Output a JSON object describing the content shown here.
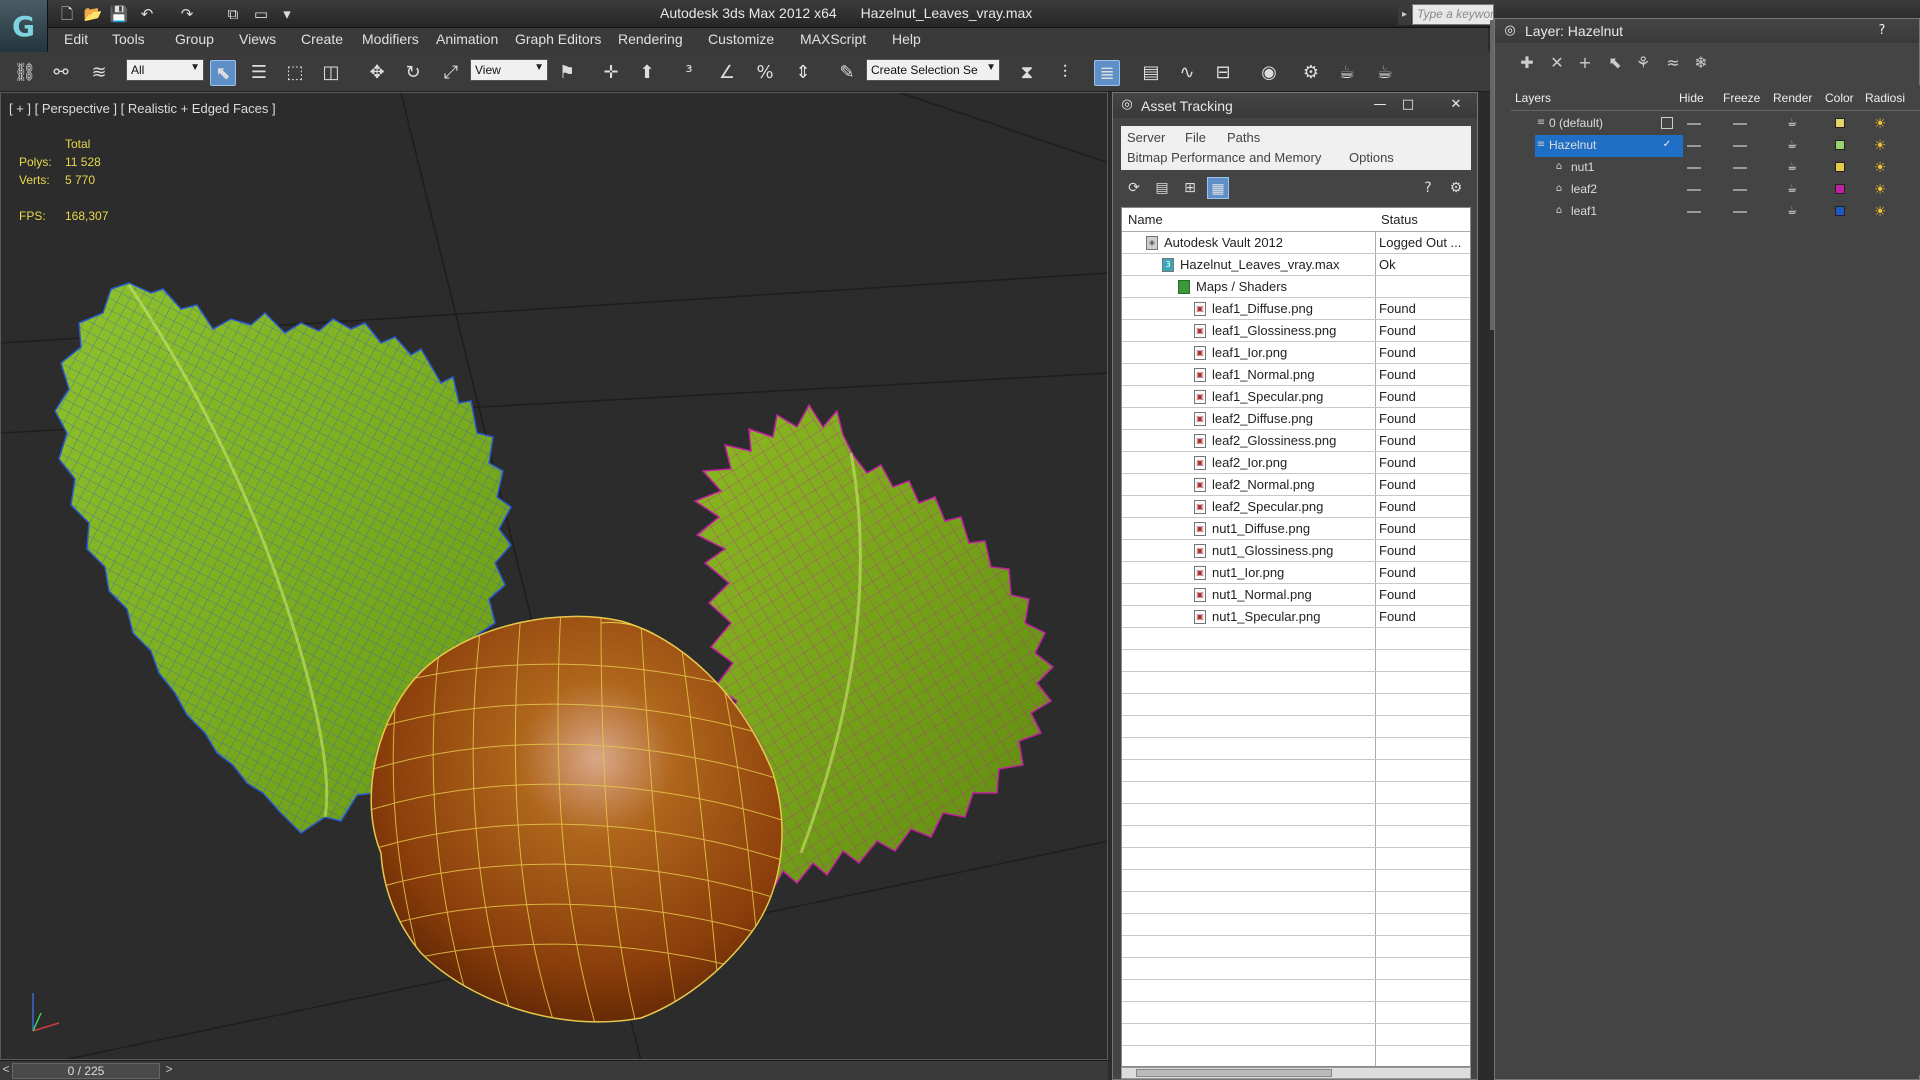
{
  "titlebar": {
    "app_name": "Autodesk 3ds Max  2012 x64",
    "file_name": "Hazelnut_Leaves_vray.max",
    "search_placeholder": "Type a keyword"
  },
  "menu": [
    "Edit",
    "Tools",
    "Group",
    "Views",
    "Create",
    "Modifiers",
    "Animation",
    "Graph Editors",
    "Rendering",
    "Customize",
    "MAXScript",
    "Help"
  ],
  "toolbar": {
    "filter_value": "All",
    "ref_coord_value": "View",
    "selection_set_placeholder": "Create Selection Se"
  },
  "viewport": {
    "label": "[ + ] [ Perspective ] [ Realistic + Edged Faces ]",
    "stats": {
      "total_label": "Total",
      "polys_label": "Polys:",
      "polys_value": "11 528",
      "verts_label": "Verts:",
      "verts_value": "5 770",
      "fps_label": "FPS:",
      "fps_value": "168,307"
    }
  },
  "timeline": {
    "frame": "0 / 225",
    "prev": "<",
    "next": ">"
  },
  "asset_tracking": {
    "title": "Asset Tracking",
    "menus_row1": [
      "Server",
      "File",
      "Paths"
    ],
    "menus_row2": [
      "Bitmap Performance and Memory",
      "Options"
    ],
    "columns": [
      "Name",
      "Status"
    ],
    "rows": [
      {
        "name": "Autodesk Vault 2012",
        "status": "Logged Out ...",
        "indent": 1,
        "icon": "vault-icon"
      },
      {
        "name": "Hazelnut_Leaves_vray.max",
        "status": "Ok",
        "indent": 2,
        "icon": "max-file-icon"
      },
      {
        "name": "Maps / Shaders",
        "status": "",
        "indent": 3,
        "icon": "maps-icon"
      },
      {
        "name": "leaf1_Diffuse.png",
        "status": "Found",
        "indent": 4,
        "icon": "image-file-icon"
      },
      {
        "name": "leaf1_Glossiness.png",
        "status": "Found",
        "indent": 4,
        "icon": "image-file-icon"
      },
      {
        "name": "leaf1_Ior.png",
        "status": "Found",
        "indent": 4,
        "icon": "image-file-icon"
      },
      {
        "name": "leaf1_Normal.png",
        "status": "Found",
        "indent": 4,
        "icon": "image-file-icon"
      },
      {
        "name": "leaf1_Specular.png",
        "status": "Found",
        "indent": 4,
        "icon": "image-file-icon"
      },
      {
        "name": "leaf2_Diffuse.png",
        "status": "Found",
        "indent": 4,
        "icon": "image-file-icon"
      },
      {
        "name": "leaf2_Glossiness.png",
        "status": "Found",
        "indent": 4,
        "icon": "image-file-icon"
      },
      {
        "name": "leaf2_Ior.png",
        "status": "Found",
        "indent": 4,
        "icon": "image-file-icon"
      },
      {
        "name": "leaf2_Normal.png",
        "status": "Found",
        "indent": 4,
        "icon": "image-file-icon"
      },
      {
        "name": "leaf2_Specular.png",
        "status": "Found",
        "indent": 4,
        "icon": "image-file-icon"
      },
      {
        "name": "nut1_Diffuse.png",
        "status": "Found",
        "indent": 4,
        "icon": "image-file-icon"
      },
      {
        "name": "nut1_Glossiness.png",
        "status": "Found",
        "indent": 4,
        "icon": "image-file-icon"
      },
      {
        "name": "nut1_Ior.png",
        "status": "Found",
        "indent": 4,
        "icon": "image-file-icon"
      },
      {
        "name": "nut1_Normal.png",
        "status": "Found",
        "indent": 4,
        "icon": "image-file-icon"
      },
      {
        "name": "nut1_Specular.png",
        "status": "Found",
        "indent": 4,
        "icon": "image-file-icon"
      }
    ],
    "empty_rows": 20
  },
  "layer_window": {
    "title": "Layer: Hazelnut",
    "columns": [
      "Layers",
      "Hide",
      "Freeze",
      "Render",
      "Color",
      "Radiosi"
    ],
    "rows": [
      {
        "name": "0 (default)",
        "color": "#e6d36a",
        "selected": false,
        "child": false
      },
      {
        "name": "Hazelnut",
        "color": "#9ad36a",
        "selected": true,
        "child": false
      },
      {
        "name": "nut1",
        "color": "#e6c84a",
        "selected": false,
        "child": true
      },
      {
        "name": "leaf2",
        "color": "#c21fa0",
        "selected": false,
        "child": true
      },
      {
        "name": "leaf1",
        "color": "#1f5ac2",
        "selected": false,
        "child": true
      }
    ]
  },
  "colors": {
    "stats_text": "#e8d84a",
    "selection_blue": "#1f6fc7",
    "leaf1_wire": "#2a5ad0",
    "leaf2_wire": "#c21fa0",
    "nut_wire": "#e6c84a"
  }
}
